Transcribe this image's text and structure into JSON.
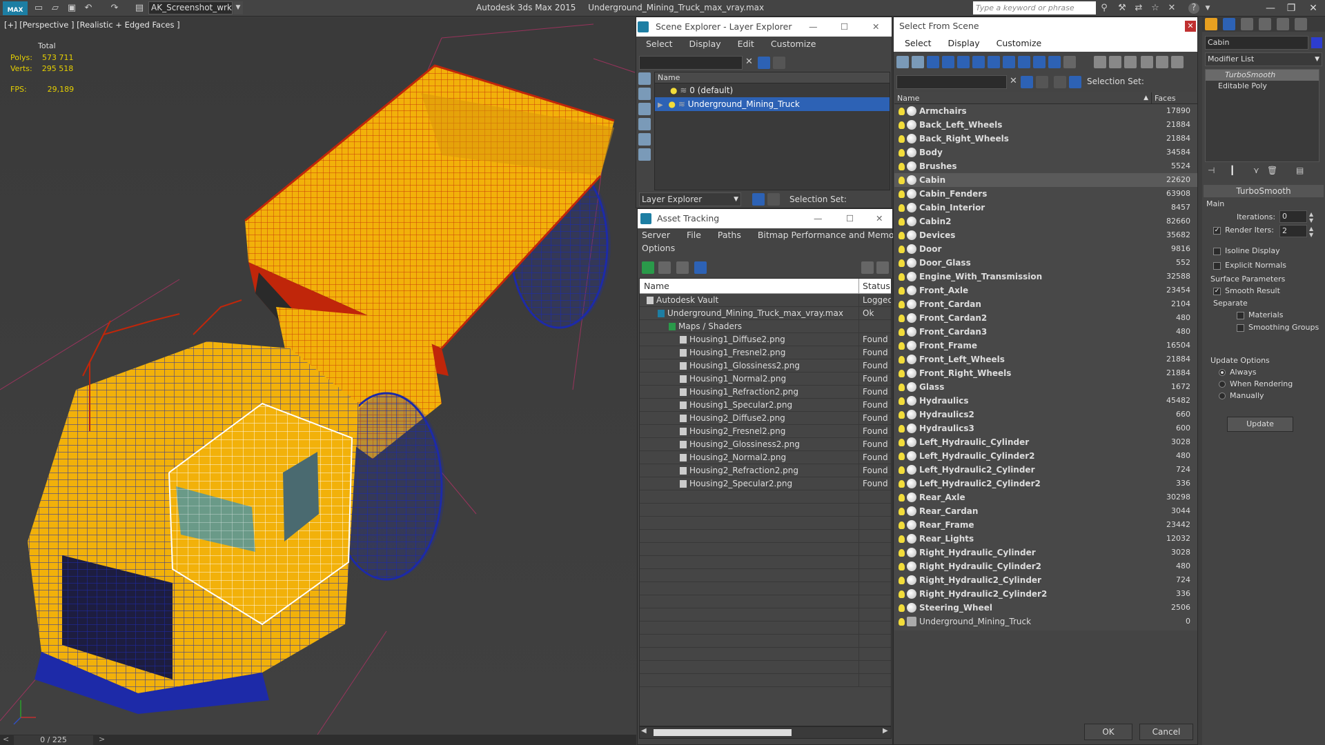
{
  "titlebar": {
    "app_logo": "MAX",
    "workspace": "AK_Screenshot_wrksp",
    "app_title": "Autodesk 3ds Max  2015",
    "file_name": "Underground_Mining_Truck_max_vray.max",
    "search_placeholder": "Type a keyword or phrase"
  },
  "viewport": {
    "label": "[+] [Perspective ] [Realistic + Edged Faces ]",
    "stats": {
      "total_label": "Total",
      "polys_label": "Polys:",
      "polys_value": "573 711",
      "verts_label": "Verts:",
      "verts_value": "295 518",
      "fps_label": "FPS:",
      "fps_value": "29,189"
    },
    "timeline": "0 / 225",
    "prev_frame": "<",
    "next_frame": ">"
  },
  "scene_explorer": {
    "title": "Scene Explorer - Layer Explorer",
    "menu": [
      "Select",
      "Display",
      "Edit",
      "Customize"
    ],
    "column_name": "Name",
    "layers": [
      {
        "name": "0 (default)",
        "selected": false
      },
      {
        "name": "Underground_Mining_Truck",
        "selected": true
      }
    ],
    "explorer_mode": "Layer Explorer",
    "selection_set_label": "Selection Set:"
  },
  "asset_tracking": {
    "title": "Asset Tracking",
    "menu": [
      "Server",
      "File",
      "Paths",
      "Bitmap Performance and Memory"
    ],
    "menu2": "Options",
    "col_name": "Name",
    "col_status": "Status",
    "rows": [
      {
        "name": "Autodesk Vault",
        "status": "Logged",
        "indent": 0,
        "icon": "vault-icon"
      },
      {
        "name": "Underground_Mining_Truck_max_vray.max",
        "status": "Ok",
        "indent": 1,
        "icon": "max-file-icon"
      },
      {
        "name": "Maps / Shaders",
        "status": "",
        "indent": 2,
        "icon": "maps-icon"
      },
      {
        "name": "Housing1_Diffuse2.png",
        "status": "Found",
        "indent": 3,
        "icon": "bitmap-icon"
      },
      {
        "name": "Housing1_Fresnel2.png",
        "status": "Found",
        "indent": 3,
        "icon": "bitmap-icon"
      },
      {
        "name": "Housing1_Glossiness2.png",
        "status": "Found",
        "indent": 3,
        "icon": "bitmap-icon"
      },
      {
        "name": "Housing1_Normal2.png",
        "status": "Found",
        "indent": 3,
        "icon": "bitmap-icon"
      },
      {
        "name": "Housing1_Refraction2.png",
        "status": "Found",
        "indent": 3,
        "icon": "bitmap-icon"
      },
      {
        "name": "Housing1_Specular2.png",
        "status": "Found",
        "indent": 3,
        "icon": "bitmap-icon"
      },
      {
        "name": "Housing2_Diffuse2.png",
        "status": "Found",
        "indent": 3,
        "icon": "bitmap-icon"
      },
      {
        "name": "Housing2_Fresnel2.png",
        "status": "Found",
        "indent": 3,
        "icon": "bitmap-icon"
      },
      {
        "name": "Housing2_Glossiness2.png",
        "status": "Found",
        "indent": 3,
        "icon": "bitmap-icon"
      },
      {
        "name": "Housing2_Normal2.png",
        "status": "Found",
        "indent": 3,
        "icon": "bitmap-icon"
      },
      {
        "name": "Housing2_Refraction2.png",
        "status": "Found",
        "indent": 3,
        "icon": "bitmap-icon"
      },
      {
        "name": "Housing2_Specular2.png",
        "status": "Found",
        "indent": 3,
        "icon": "bitmap-icon"
      }
    ]
  },
  "select_from_scene": {
    "title": "Select From Scene",
    "menu": [
      "Select",
      "Display",
      "Customize"
    ],
    "selection_set_label": "Selection Set:",
    "col_name": "Name",
    "col_faces": "Faces",
    "ok": "OK",
    "cancel": "Cancel",
    "objects": [
      {
        "name": "Armchairs",
        "faces": "17890"
      },
      {
        "name": "Back_Left_Wheels",
        "faces": "21884"
      },
      {
        "name": "Back_Right_Wheels",
        "faces": "21884"
      },
      {
        "name": "Body",
        "faces": "34584"
      },
      {
        "name": "Brushes",
        "faces": "5524"
      },
      {
        "name": "Cabin",
        "faces": "22620",
        "selected": true
      },
      {
        "name": "Cabin_Fenders",
        "faces": "63908"
      },
      {
        "name": "Cabin_Interior",
        "faces": "8457"
      },
      {
        "name": "Cabin2",
        "faces": "82660"
      },
      {
        "name": "Devices",
        "faces": "35682"
      },
      {
        "name": "Door",
        "faces": "9816"
      },
      {
        "name": "Door_Glass",
        "faces": "552"
      },
      {
        "name": "Engine_With_Transmission",
        "faces": "32588"
      },
      {
        "name": "Front_Axle",
        "faces": "23454"
      },
      {
        "name": "Front_Cardan",
        "faces": "2104"
      },
      {
        "name": "Front_Cardan2",
        "faces": "480"
      },
      {
        "name": "Front_Cardan3",
        "faces": "480"
      },
      {
        "name": "Front_Frame",
        "faces": "16504"
      },
      {
        "name": "Front_Left_Wheels",
        "faces": "21884"
      },
      {
        "name": "Front_Right_Wheels",
        "faces": "21884"
      },
      {
        "name": "Glass",
        "faces": "1672"
      },
      {
        "name": "Hydraulics",
        "faces": "45482"
      },
      {
        "name": "Hydraulics2",
        "faces": "660"
      },
      {
        "name": "Hydraulics3",
        "faces": "600"
      },
      {
        "name": "Left_Hydraulic_Cylinder",
        "faces": "3028"
      },
      {
        "name": "Left_Hydraulic_Cylinder2",
        "faces": "480"
      },
      {
        "name": "Left_Hydraulic2_Cylinder",
        "faces": "724"
      },
      {
        "name": "Left_Hydraulic2_Cylinder2",
        "faces": "336"
      },
      {
        "name": "Rear_Axle",
        "faces": "30298"
      },
      {
        "name": "Rear_Cardan",
        "faces": "3044"
      },
      {
        "name": "Rear_Frame",
        "faces": "23442"
      },
      {
        "name": "Rear_Lights",
        "faces": "12032"
      },
      {
        "name": "Right_Hydraulic_Cylinder",
        "faces": "3028"
      },
      {
        "name": "Right_Hydraulic_Cylinder2",
        "faces": "480"
      },
      {
        "name": "Right_Hydraulic2_Cylinder",
        "faces": "724"
      },
      {
        "name": "Right_Hydraulic2_Cylinder2",
        "faces": "336"
      },
      {
        "name": "Steering_Wheel",
        "faces": "2506"
      },
      {
        "name": "Underground_Mining_Truck",
        "faces": "0",
        "group": true
      }
    ]
  },
  "command_panel": {
    "object_name": "Cabin",
    "modifier_list": "Modifier List",
    "stack": [
      "TurboSmooth",
      "Editable Poly"
    ],
    "rollout_title": "TurboSmooth",
    "main_label": "Main",
    "iterations_label": "Iterations:",
    "iterations_value": "0",
    "render_iters_label": "Render Iters:",
    "render_iters_value": "2",
    "isoline_label": "Isoline Display",
    "explicit_normals_label": "Explicit Normals",
    "surface_params_label": "Surface Parameters",
    "smooth_result_label": "Smooth Result",
    "separate_label": "Separate",
    "materials_label": "Materials",
    "smoothing_groups_label": "Smoothing Groups",
    "update_options_label": "Update Options",
    "always_label": "Always",
    "when_rendering_label": "When Rendering",
    "manually_label": "Manually",
    "update_button": "Update"
  },
  "colors": {
    "truck_yellow": "#f2b10a",
    "wire_blue": "#1d2aa8",
    "wire_red": "#c0260a",
    "selection_blue": "#2d62b5",
    "accent_teal": "#1d7ea3"
  }
}
